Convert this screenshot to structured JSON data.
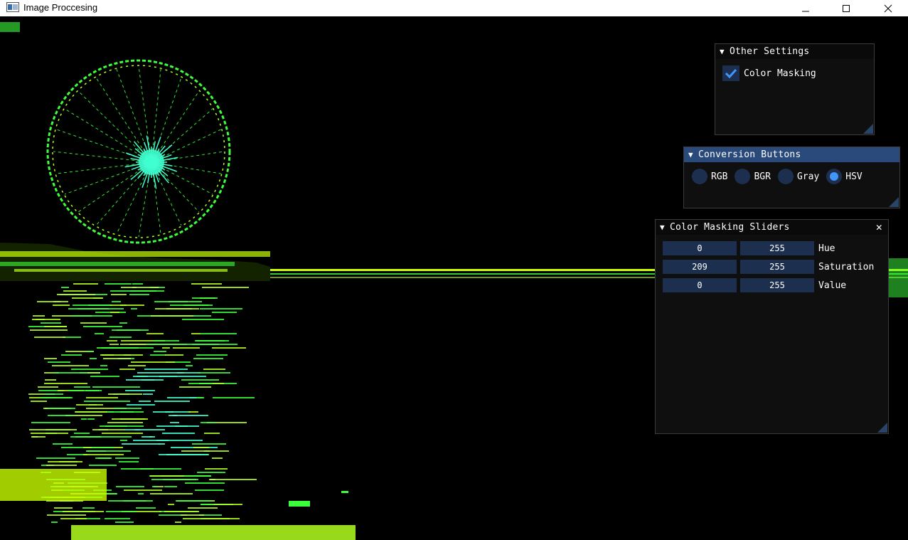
{
  "window": {
    "title": "Image Proccesing",
    "icon": "app-window-icon",
    "controls": {
      "minimize": "minimize-icon",
      "maximize": "maximize-icon",
      "close": "close-icon"
    }
  },
  "other_settings": {
    "title": "Other Settings",
    "checkbox_label": "Color Masking",
    "checked": true
  },
  "conversion_buttons": {
    "title": "Conversion Buttons",
    "options": [
      "RGB",
      "BGR",
      "Gray",
      "HSV"
    ],
    "selected": "HSV"
  },
  "color_masking_sliders": {
    "title": "Color Masking Sliders",
    "rows": [
      {
        "min": "0",
        "max": "255",
        "label": "Hue"
      },
      {
        "min": "209",
        "max": "255",
        "label": "Saturation"
      },
      {
        "min": "0",
        "max": "255",
        "label": "Value"
      }
    ]
  },
  "colors": {
    "panel_bg": "#0f0f10",
    "title_active": "#294a7a",
    "frame_bg": "#1d2f4e",
    "accent": "#4296fa",
    "mask_green": "#3cff3c",
    "mask_yellow": "#c8ff00",
    "mask_cyan": "#40ffd0"
  }
}
